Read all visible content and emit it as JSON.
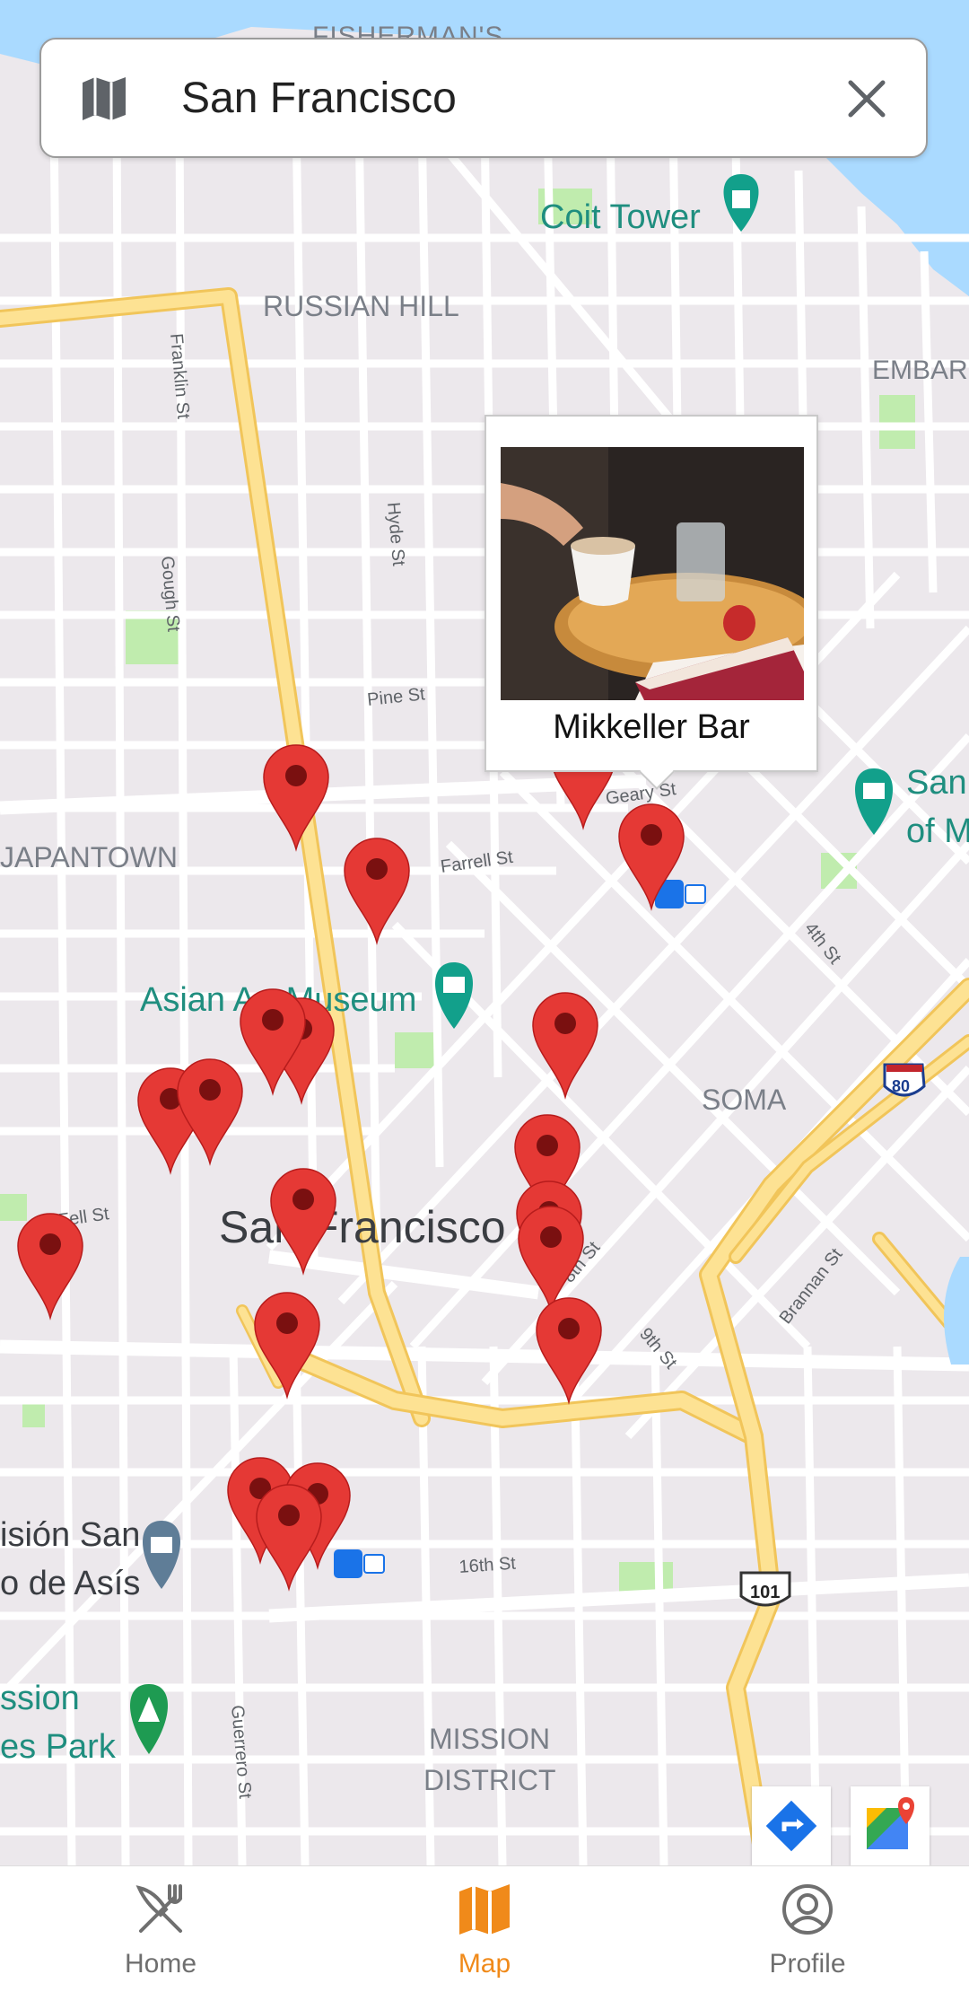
{
  "search": {
    "value": "San Francisco",
    "leading_icon": "map-icon",
    "trailing_icon": "close-icon"
  },
  "map": {
    "labels": {
      "fishermans": "FISHERMAN'S",
      "coit_tower": "Coit Tower",
      "russian_hill": "RUSSIAN HILL",
      "embarcadero": "EMBARC",
      "franklin": "Franklin St",
      "hyde": "Hyde St",
      "gough": "Gough St",
      "pine": "Pine St",
      "japantown": "JAPANTOWN",
      "ofarrell": "Farrell St",
      "geary": "Geary St",
      "sfmoma_1": "San",
      "sfmoma_2": "of M",
      "asian_art": "Asian Art Museum",
      "fourth": "4th St",
      "soma": "SOMA",
      "i80": "80",
      "fell": "Fell St",
      "san_francisco": "San Francisco",
      "eighth": "8th St",
      "ninth": "9th St",
      "brannan": "Brannan St",
      "mission_san_1": "isión San",
      "mission_san_2": "o de Asís",
      "sixteenth": "16th St",
      "us101": "101",
      "mission_park_1": "ssion",
      "mission_park_2": "es Park",
      "guerrero": "Guerrero St",
      "mission_district_1": "MISSION",
      "mission_district_2": "DISTRICT"
    }
  },
  "popup": {
    "title": "Mikkeller Bar"
  },
  "map_buttons": {
    "directions": "directions-icon",
    "google_maps": "google-maps-icon"
  },
  "nav": {
    "items": [
      {
        "label": "Home",
        "icon": "fork-knife-icon"
      },
      {
        "label": "Map",
        "icon": "map-icon"
      },
      {
        "label": "Profile",
        "icon": "person-icon"
      }
    ],
    "active_color": "#f08a1a",
    "inactive_color": "#6f6f6f"
  },
  "colors": {
    "pin": "#e53935",
    "highway": "#fde293",
    "water": "#aadaff",
    "park": "#c0ecae"
  }
}
